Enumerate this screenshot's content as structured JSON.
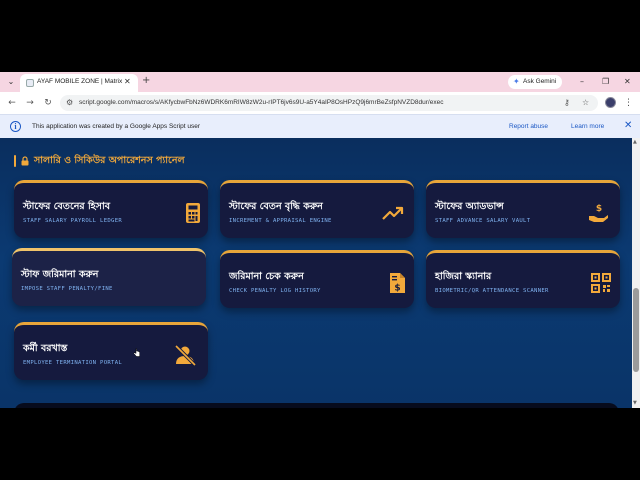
{
  "browser": {
    "tab": {
      "title": "AYAF MOBILE ZONE | Matrix Ne",
      "close": "✕"
    },
    "new_tab": "+",
    "gemini": {
      "label": "Ask Gemini"
    },
    "window": {
      "minimize": "–",
      "maximize": "❐",
      "close": "✕"
    },
    "url": "script.google.com/macros/s/AKfycbwFbNz6WDRK6mRIW8zW2u-rIPT6jv6s9U-a5Y4aIP8OsHPzQ9j6mrBeZsfpNVZD8dur/exec",
    "icons": [
      "tab-list-icon",
      "back-icon",
      "forward-icon",
      "reload-icon",
      "site-info-icon",
      "extension-icon",
      "star-icon",
      "profile-avatar",
      "menu-icon"
    ]
  },
  "banner": {
    "text": "This application was created by a Google Apps Script user",
    "report_abuse": "Report abuse",
    "learn_more": "Learn more"
  },
  "section": {
    "title": "সালারি ও সিকিউর অপারেশনস প্যানেল",
    "accent_color": "#f2a93b"
  },
  "cards": [
    {
      "title": "স্টাফের বেতনের হিসাব",
      "subtitle": "STAFF SALARY PAYROLL LEDGER",
      "icon": "calculator-icon"
    },
    {
      "title": "স্টাফের বেতন বৃদ্ধি করুন",
      "subtitle": "INCREMENT & APPRAISAL ENGINE",
      "icon": "trending-up-icon"
    },
    {
      "title": "স্টাফের অ্যাডভান্স",
      "subtitle": "STAFF ADVANCE SALARY VAULT",
      "icon": "hand-dollar-icon"
    },
    {
      "title": "স্টাফ জরিমানা করুন",
      "subtitle": "IMPOSE STAFF PENALTY/FINE",
      "icon": "none"
    },
    {
      "title": "জরিমানা চেক করুন",
      "subtitle": "CHECK PENALTY LOG HISTORY",
      "icon": "invoice-dollar-icon"
    },
    {
      "title": "হাজিরা স্ক্যানার",
      "subtitle": "BIOMETRIC/QR ATTENDANCE SCANNER",
      "icon": "qr-code-icon"
    },
    {
      "title": "কর্মী বরখাস্ত",
      "subtitle": "EMPLOYEE TERMINATION PORTAL",
      "icon": "user-slash-icon"
    }
  ]
}
